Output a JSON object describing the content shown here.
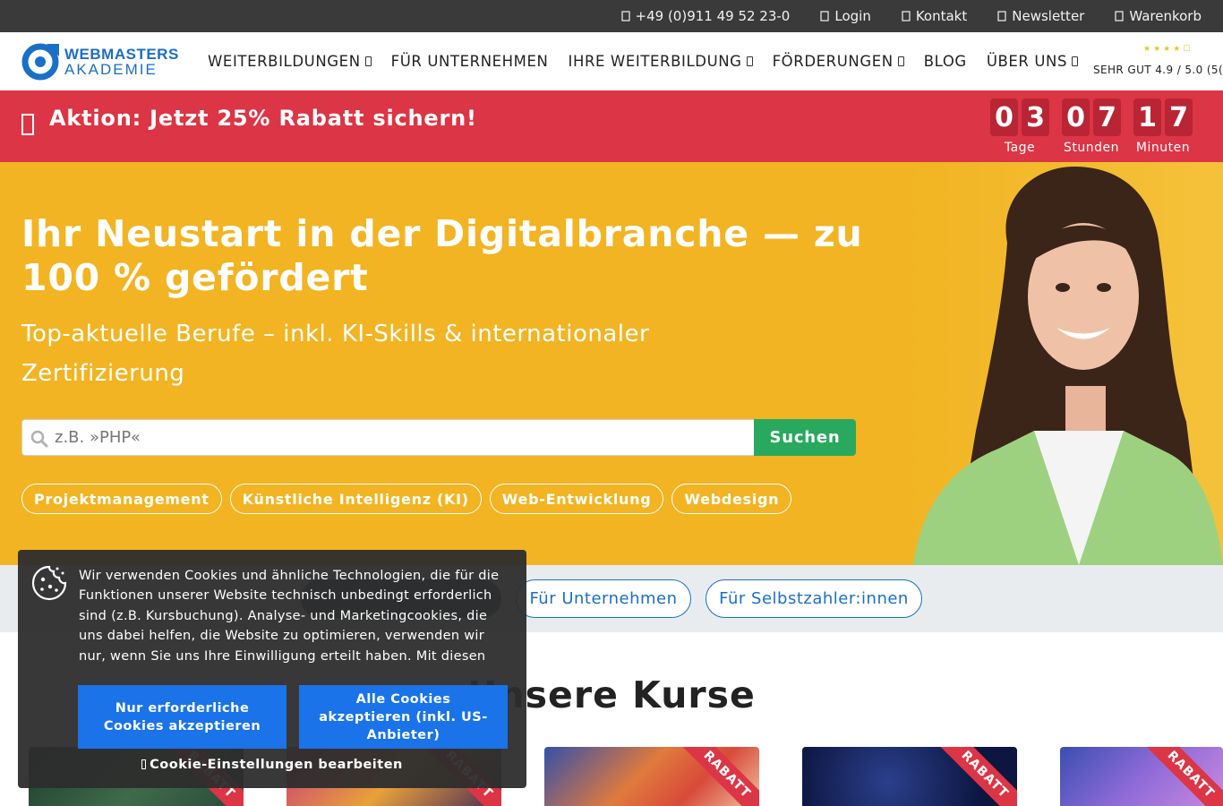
{
  "topbar": {
    "phone": "+49 (0)911 49 52 23-0",
    "login": "Login",
    "contact": "Kontakt",
    "newsletter": "Newsletter",
    "cart": "Warenkorb"
  },
  "logo": {
    "line1": "WEBMASTERS",
    "line2": "AKADEMIE"
  },
  "nav": {
    "items": [
      {
        "label": "WEITERBILDUNGEN",
        "dropdown": true
      },
      {
        "label": "FÜR UNTERNEHMEN",
        "dropdown": false
      },
      {
        "label": "IHRE WEITERBILDUNG",
        "dropdown": true
      },
      {
        "label": "FÖRDERUNGEN",
        "dropdown": true
      },
      {
        "label": "BLOG",
        "dropdown": false
      },
      {
        "label": "ÜBER UNS",
        "dropdown": true
      }
    ],
    "rating_text": "SEHR GUT 4.9 / 5.0 (5("
  },
  "promo": {
    "text": "Aktion: Jetzt 25% Rabatt sichern!",
    "countdown": {
      "days": [
        "0",
        "3"
      ],
      "days_label": "Tage",
      "hours": [
        "0",
        "7"
      ],
      "hours_label": "Stunden",
      "minutes": [
        "1",
        "7"
      ],
      "minutes_label": "Minuten"
    }
  },
  "hero": {
    "title": "Ihr Neustart in der Digitalbranche — zu 100 % gefördert",
    "subtitle": "Top-aktuelle Berufe – inkl. KI-Skills & internationaler Zertifizierung",
    "search_placeholder": "z.B. »PHP«",
    "search_button": "Suchen",
    "tags": [
      "Projektmanagement",
      "Künstliche Intelligenz (KI)",
      "Web-Entwicklung",
      "Webdesign"
    ]
  },
  "audience": {
    "pills": [
      "Für Unternehmen",
      "Für Selbstzahler:innen"
    ]
  },
  "courses": {
    "title": "Unsere Kurse",
    "ribbon": "RABATT"
  },
  "cookie": {
    "text": "Wir verwenden Cookies und ähnliche Technologien, die für die Funktionen unserer Website technisch unbedingt erforderlich sind (z.B. Kursbuchung). Analyse- und Marketingcookies, die uns dabei helfen, die Website zu optimieren, verwenden wir nur, wenn Sie uns Ihre Einwilligung erteilt haben. Mit diesen",
    "btn_required": "Nur erforderliche Cookies akzeptieren",
    "btn_all": "Alle Cookies akzeptieren (inkl. US-Anbieter)",
    "settings": "Cookie-Einstellungen bearbeiten"
  },
  "colors": {
    "topbar": "#3a3a3a",
    "brand_blue": "#1a6fc7",
    "promo_red": "#dc3545",
    "hero_yellow": "#f2b422",
    "search_green": "#28a95e",
    "cookie_button": "#1a73e8"
  }
}
